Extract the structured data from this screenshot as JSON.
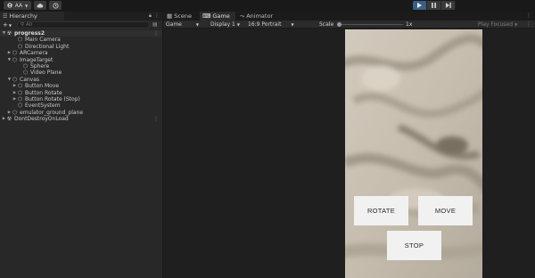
{
  "toolbar": {
    "account_label": "AA",
    "account_icon": "account-icon",
    "cloud_icon": "cloud-icon",
    "history_icon": "history-icon",
    "play_icon": "play-icon",
    "pause_icon": "pause-icon",
    "step_icon": "step-icon",
    "accent_color": "#3c5e86"
  },
  "hierarchy": {
    "tab_title": "Hierarchy",
    "search_placeholder": "All",
    "rows": [
      {
        "label": "progress2",
        "depth": 0,
        "arrow": "▼",
        "icon": "scene-icon",
        "bold": true,
        "more": true
      },
      {
        "label": "Main Camera",
        "depth": 2,
        "arrow": "",
        "icon": "gameobject-icon"
      },
      {
        "label": "Directional Light",
        "depth": 2,
        "arrow": "",
        "icon": "gameobject-icon"
      },
      {
        "label": "ARCamera",
        "depth": 1,
        "arrow": "▶",
        "icon": "gameobject-icon"
      },
      {
        "label": "ImageTarget",
        "depth": 1,
        "arrow": "▼",
        "icon": "gameobject-icon"
      },
      {
        "label": "Sphere",
        "depth": 3,
        "arrow": "",
        "icon": "gameobject-icon"
      },
      {
        "label": "Video Plane",
        "depth": 3,
        "arrow": "",
        "icon": "gameobject-icon"
      },
      {
        "label": "Canvas",
        "depth": 1,
        "arrow": "▼",
        "icon": "gameobject-icon"
      },
      {
        "label": "Button Move",
        "depth": 2,
        "arrow": "▶",
        "icon": "gameobject-icon"
      },
      {
        "label": "Button Rotate",
        "depth": 2,
        "arrow": "▶",
        "icon": "gameobject-icon"
      },
      {
        "label": "Button Rotate (Stop)",
        "depth": 2,
        "arrow": "▶",
        "icon": "gameobject-icon"
      },
      {
        "label": "EventSystem",
        "depth": 2,
        "arrow": "",
        "icon": "gameobject-icon"
      },
      {
        "label": "emulator_ground_plane",
        "depth": 1,
        "arrow": "▶",
        "icon": "gameobject-icon"
      },
      {
        "label": "DontDestroyOnLoad",
        "depth": 0,
        "arrow": "▶",
        "icon": "scene-icon",
        "bold": false,
        "more": true
      }
    ]
  },
  "gameview": {
    "tabs": [
      {
        "label": "Scene",
        "icon": "scene-grid-icon"
      },
      {
        "label": "Game",
        "icon": "gamepad-icon"
      },
      {
        "label": "Animator",
        "icon": "animator-icon"
      }
    ],
    "game_dropdown": "Game",
    "display_dropdown": "Display 1",
    "aspect_dropdown": "16:9 Portrait",
    "scale_label": "Scale",
    "scale_value": "1x",
    "scale_fraction": 0,
    "play_focused": "Play Focused"
  },
  "screen_buttons": {
    "rotate": "ROTATE",
    "move": "MOVE",
    "stop": "STOP"
  }
}
